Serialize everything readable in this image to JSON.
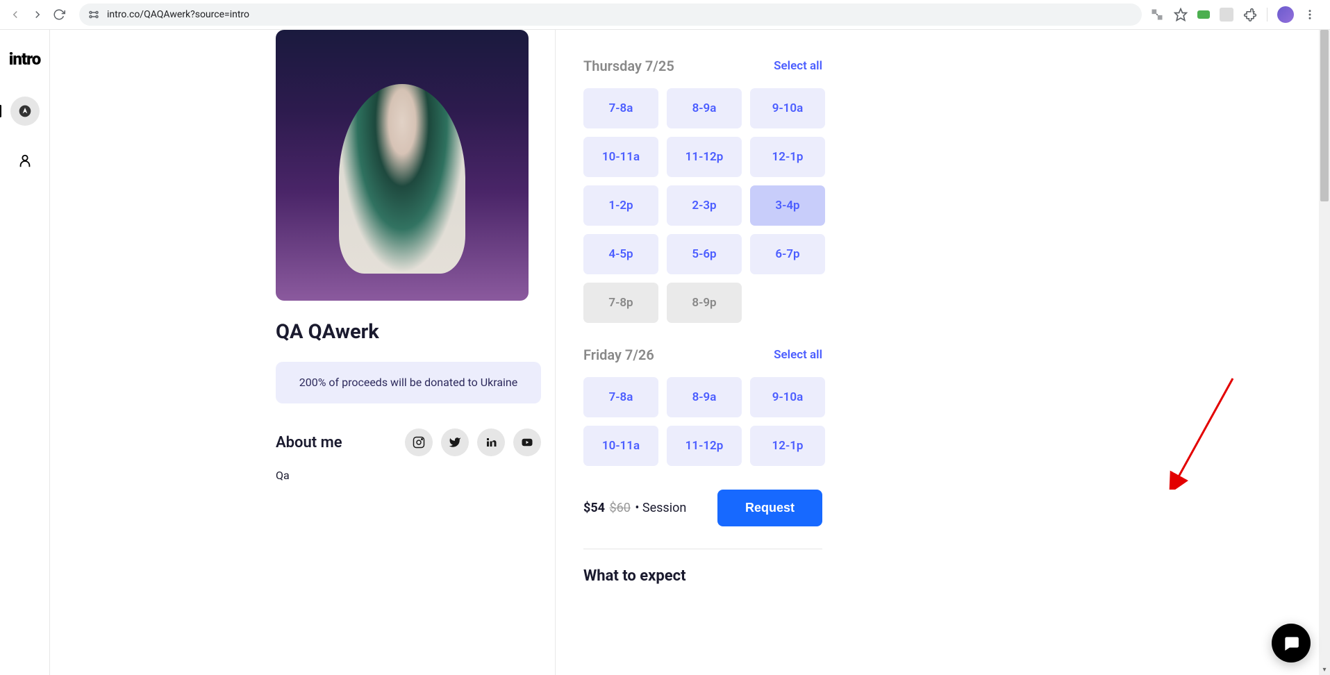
{
  "browser": {
    "url": "intro.co/QAQAwerk?source=intro"
  },
  "sidebar": {
    "logo": "intro"
  },
  "profile": {
    "name": "QA QAwerk",
    "donation_text": "200% of proceeds will be donated to Ukraine",
    "about_label": "About me",
    "about_text": "Qa"
  },
  "booking": {
    "days": [
      {
        "label": "Thursday 7/25",
        "select_all": "Select all",
        "slots": [
          {
            "label": "7-8a",
            "state": "avail"
          },
          {
            "label": "8-9a",
            "state": "avail"
          },
          {
            "label": "9-10a",
            "state": "avail"
          },
          {
            "label": "10-11a",
            "state": "avail"
          },
          {
            "label": "11-12p",
            "state": "avail"
          },
          {
            "label": "12-1p",
            "state": "avail"
          },
          {
            "label": "1-2p",
            "state": "avail"
          },
          {
            "label": "2-3p",
            "state": "avail"
          },
          {
            "label": "3-4p",
            "state": "selected"
          },
          {
            "label": "4-5p",
            "state": "avail"
          },
          {
            "label": "5-6p",
            "state": "avail"
          },
          {
            "label": "6-7p",
            "state": "avail"
          },
          {
            "label": "7-8p",
            "state": "disabled"
          },
          {
            "label": "8-9p",
            "state": "disabled"
          }
        ]
      },
      {
        "label": "Friday 7/26",
        "select_all": "Select all",
        "slots": [
          {
            "label": "7-8a",
            "state": "avail"
          },
          {
            "label": "8-9a",
            "state": "avail"
          },
          {
            "label": "9-10a",
            "state": "avail"
          },
          {
            "label": "10-11a",
            "state": "avail"
          },
          {
            "label": "11-12p",
            "state": "avail"
          },
          {
            "label": "12-1p",
            "state": "avail"
          }
        ]
      }
    ],
    "price": "$54",
    "price_original": "$60",
    "price_suffix": "Session",
    "request_label": "Request",
    "expect_heading": "What to expect"
  }
}
